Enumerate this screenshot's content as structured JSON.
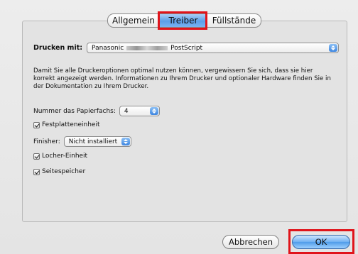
{
  "tabs": [
    {
      "label": "Allgemein",
      "selected": false
    },
    {
      "label": "Treiber",
      "selected": true
    },
    {
      "label": "Füllstände",
      "selected": false
    }
  ],
  "print_with": {
    "label": "Drucken mit:",
    "value_prefix": "Panasonic",
    "value_suffix": "PostScript"
  },
  "description": "Damit Sie alle Druckeroptionen optimal nutzen können, vergewissern Sie sich, dass sie hier korrekt angezeigt werden. Informationen zu Ihrem Drucker und optionaler Hardware finden Sie in der Dokumentation zu Ihrem Drucker.",
  "tray_count": {
    "label": "Nummer das Papierfachs:",
    "value": "4"
  },
  "options": {
    "hard_disk": {
      "label": "Festplatteneinheit",
      "checked": true
    },
    "finisher": {
      "label": "Finisher:",
      "value": "Nicht installiert"
    },
    "punch": {
      "label": "Locher-Einheit",
      "checked": true
    },
    "page_memory": {
      "label": "Seitespeicher",
      "checked": true
    }
  },
  "buttons": {
    "cancel": "Abbrechen",
    "ok": "OK"
  },
  "colors": {
    "highlight": "#e0141b",
    "accent": "#5c9fe8"
  }
}
